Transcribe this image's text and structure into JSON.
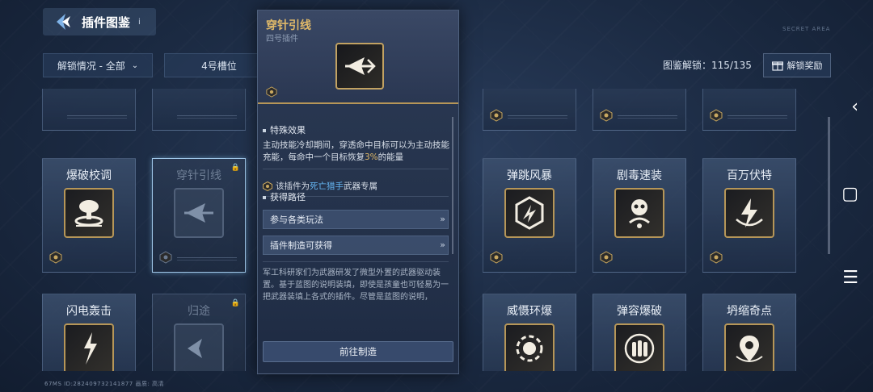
{
  "header": {
    "title": "插件图鉴",
    "info": "i"
  },
  "top_right_deco": "SECRET AREA",
  "filters": {
    "unlock": "解锁情况 - 全部",
    "slot": "4号槽位"
  },
  "unlock_stat": "图鉴解锁：115/135",
  "reward_button": "解锁奖励",
  "cards_row2": [
    {
      "name": "爆破校调"
    },
    {
      "name": "穿针引线"
    },
    {
      "name": "弹跳风暴"
    },
    {
      "name": "剧毒速装"
    },
    {
      "name": "百万伏特"
    }
  ],
  "cards_row3": [
    {
      "name": "闪电轰击"
    },
    {
      "name": "归途"
    },
    {
      "name": "威慑环爆"
    },
    {
      "name": "弹容爆破"
    },
    {
      "name": "坍缩奇点"
    }
  ],
  "popup": {
    "title": "穿针引线",
    "subtitle": "四号插件",
    "section_effect": "特殊效果",
    "effect_part1": "主动技能冷却期间，穿透命中目标可以为主动技能充能，每命中一个目标恢复",
    "effect_highlight": "3%",
    "effect_part2": "的能量",
    "exclusive_prefix": "该插件为",
    "exclusive_weapon": "死亡猎手",
    "exclusive_suffix": "武器专属",
    "section_source": "获得路径",
    "path1": "参与各类玩法",
    "path2": "插件制造可获得",
    "lore": "军工科研家们为武器研发了微型外置的武器驱动装置。基于蓝图的说明装填，即使是孩童也可轻易为一把武器装填上各式的插件。尽管是蓝图的说明，",
    "go_button": "前往制造"
  },
  "status_bar": "67MS   ID:282409732141877   画质: 高清",
  "colors": {
    "gold": "#e0b969",
    "blue": "#66b8f5",
    "frame": "#b69658"
  }
}
